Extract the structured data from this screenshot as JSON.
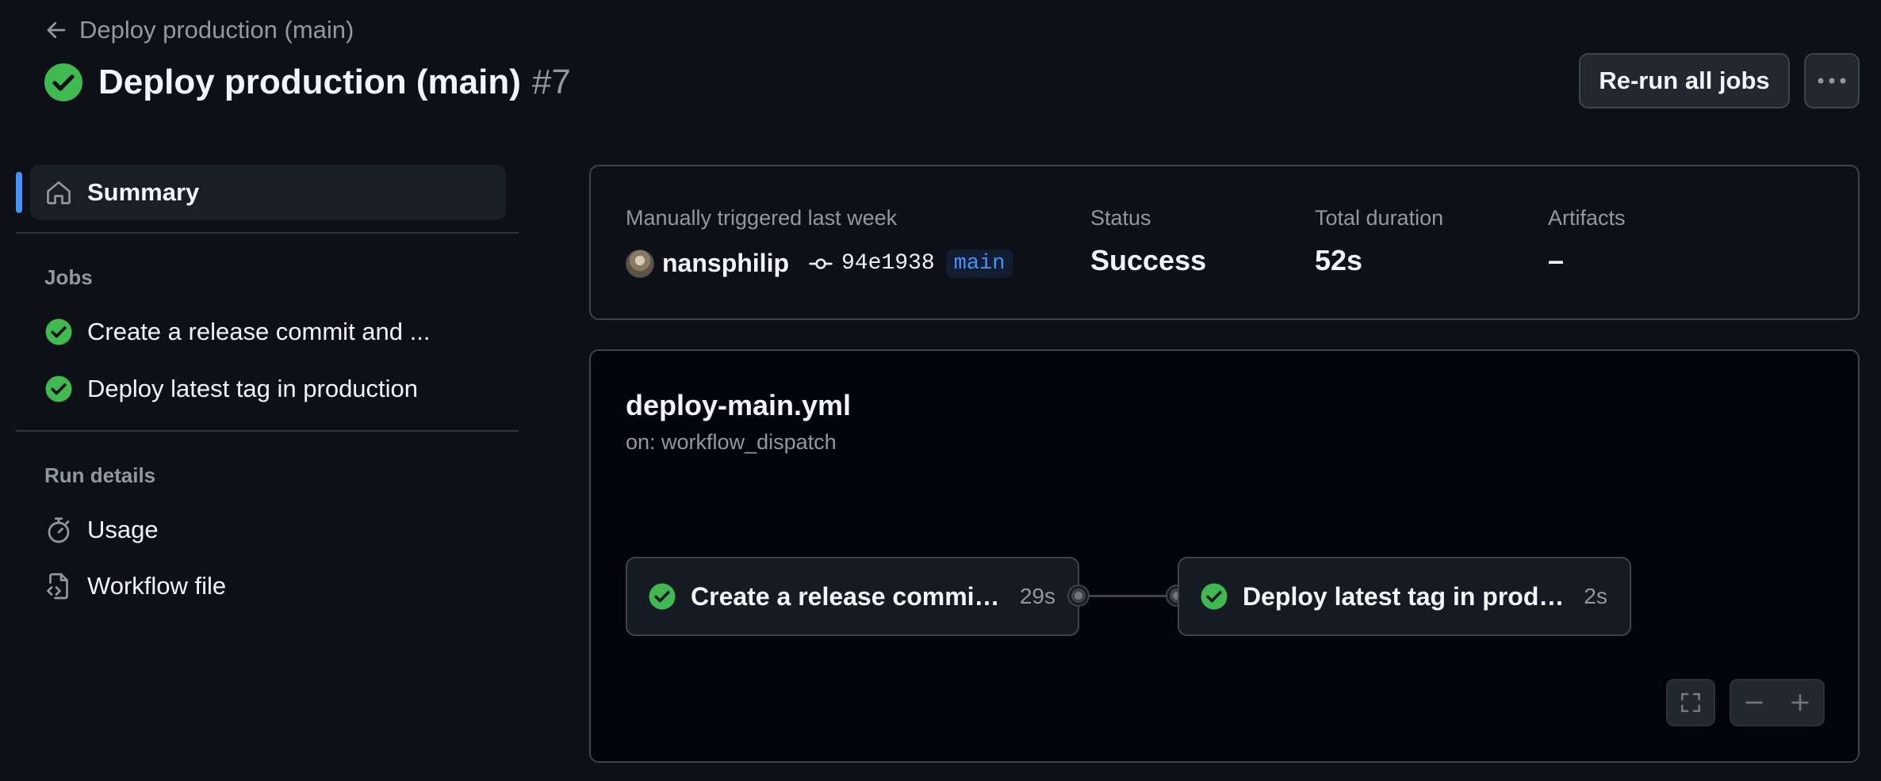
{
  "header": {
    "back_label": "Deploy production (main)",
    "title": "Deploy production (main)",
    "run_number": "#7",
    "status_icon": "check-circle-fill-icon",
    "rerun_label": "Re-run all jobs",
    "more_icon": "kebab-horizontal-icon"
  },
  "sidebar": {
    "summary_label": "Summary",
    "jobs_heading": "Jobs",
    "jobs": [
      {
        "label": "Create a release commit and ...",
        "status": "success"
      },
      {
        "label": "Deploy latest tag in production",
        "status": "success"
      }
    ],
    "run_details_heading": "Run details",
    "run_details": [
      {
        "label": "Usage",
        "icon": "stopwatch-icon"
      },
      {
        "label": "Workflow file",
        "icon": "file-code-icon"
      }
    ]
  },
  "summary": {
    "trigger_label": "Manually triggered last week",
    "actor": "nansphilip",
    "commit_sha": "94e1938",
    "branch": "main",
    "status_label": "Status",
    "status_value": "Success",
    "duration_label": "Total duration",
    "duration_value": "52s",
    "artifacts_label": "Artifacts",
    "artifacts_value": "–"
  },
  "graph": {
    "workflow_file": "deploy-main.yml",
    "trigger": "on: workflow_dispatch",
    "jobs": [
      {
        "name": "Create a release commit and tag",
        "duration": "29s",
        "status": "success"
      },
      {
        "name": "Deploy latest tag in production",
        "duration": "2s",
        "status": "success"
      }
    ],
    "controls": [
      "fullscreen-icon",
      "zoom-out-icon",
      "zoom-in-icon"
    ]
  },
  "colors": {
    "background": "#0d1117",
    "success": "#3fb950",
    "accent": "#4493f8",
    "border": "#3d444d",
    "muted_text": "#9198a1"
  }
}
